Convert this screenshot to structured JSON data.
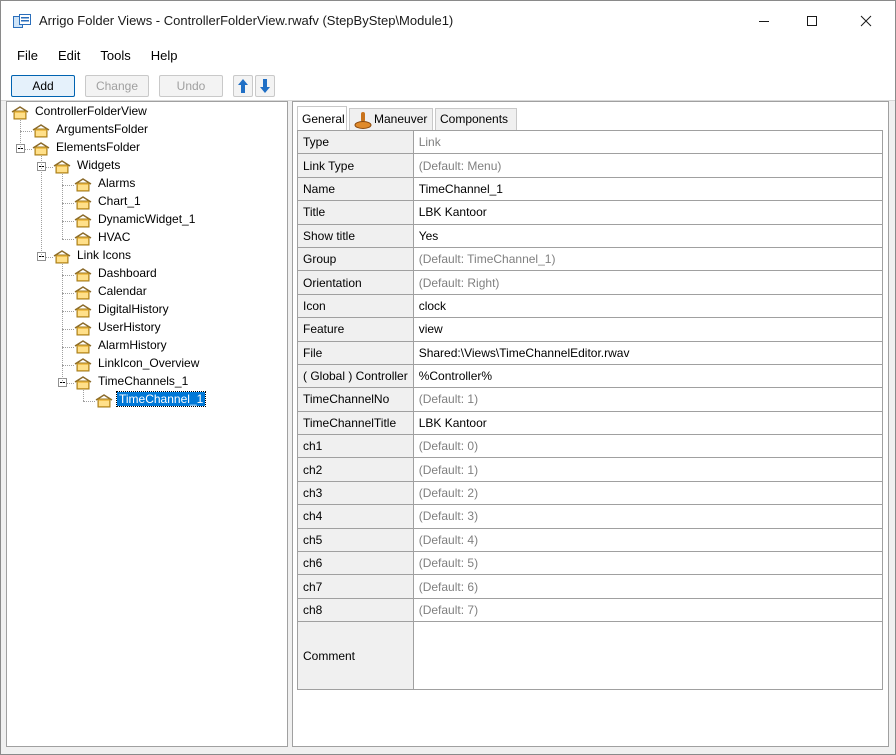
{
  "window": {
    "title": "Arrigo Folder Views - ControllerFolderView.rwafv (StepByStep\\Module1)"
  },
  "menu": [
    "File",
    "Edit",
    "Tools",
    "Help"
  ],
  "toolbar": {
    "add": "Add",
    "change": "Change",
    "undo": "Undo"
  },
  "tree": [
    {
      "label": "ControllerFolderView",
      "depth": 0
    },
    {
      "label": "ArgumentsFolder",
      "depth": 1
    },
    {
      "label": "ElementsFolder",
      "depth": 1
    },
    {
      "label": "Widgets",
      "depth": 2
    },
    {
      "label": "Alarms",
      "depth": 3
    },
    {
      "label": "Chart_1",
      "depth": 3
    },
    {
      "label": "DynamicWidget_1",
      "depth": 3
    },
    {
      "label": "HVAC",
      "depth": 3
    },
    {
      "label": "Link Icons",
      "depth": 2
    },
    {
      "label": "Dashboard",
      "depth": 3
    },
    {
      "label": "Calendar",
      "depth": 3
    },
    {
      "label": "DigitalHistory",
      "depth": 3
    },
    {
      "label": "UserHistory",
      "depth": 3
    },
    {
      "label": "AlarmHistory",
      "depth": 3
    },
    {
      "label": "LinkIcon_Overview",
      "depth": 3
    },
    {
      "label": "TimeChannels_1",
      "depth": 3
    },
    {
      "label": "TimeChannel_1",
      "depth": 4,
      "selected": true
    }
  ],
  "tabs": [
    "General",
    "Maneuver",
    "Components"
  ],
  "properties": [
    {
      "key": "Type",
      "value": "Link",
      "default": true
    },
    {
      "key": "Link Type",
      "value": "(Default: Menu)",
      "default": true
    },
    {
      "key": "Name",
      "value": "TimeChannel_1",
      "default": false
    },
    {
      "key": "Title",
      "value": "LBK Kantoor",
      "default": false
    },
    {
      "key": "Show title",
      "value": "Yes",
      "default": false
    },
    {
      "key": "Group",
      "value": "(Default: TimeChannel_1)",
      "default": true
    },
    {
      "key": "Orientation",
      "value": "(Default: Right)",
      "default": true
    },
    {
      "key": "Icon",
      "value": "clock",
      "default": false
    },
    {
      "key": "Feature",
      "value": "view",
      "default": false
    },
    {
      "key": "File",
      "value": "Shared:\\Views\\TimeChannelEditor.rwav",
      "default": false
    },
    {
      "key": "( Global ) Controller",
      "value": "%Controller%",
      "default": false
    },
    {
      "key": "TimeChannelNo",
      "value": "(Default: 1)",
      "default": true
    },
    {
      "key": "TimeChannelTitle",
      "value": "LBK Kantoor",
      "default": false
    },
    {
      "key": "ch1",
      "value": "(Default: 0)",
      "default": true
    },
    {
      "key": "ch2",
      "value": "(Default: 1)",
      "default": true
    },
    {
      "key": "ch3",
      "value": "(Default: 2)",
      "default": true
    },
    {
      "key": "ch4",
      "value": "(Default: 3)",
      "default": true
    },
    {
      "key": "ch5",
      "value": "(Default: 4)",
      "default": true
    },
    {
      "key": "ch6",
      "value": "(Default: 5)",
      "default": true
    },
    {
      "key": "ch7",
      "value": "(Default: 6)",
      "default": true
    },
    {
      "key": "ch8",
      "value": "(Default: 7)",
      "default": true
    },
    {
      "key": "Comment",
      "value": "",
      "default": false,
      "tall": true
    }
  ]
}
